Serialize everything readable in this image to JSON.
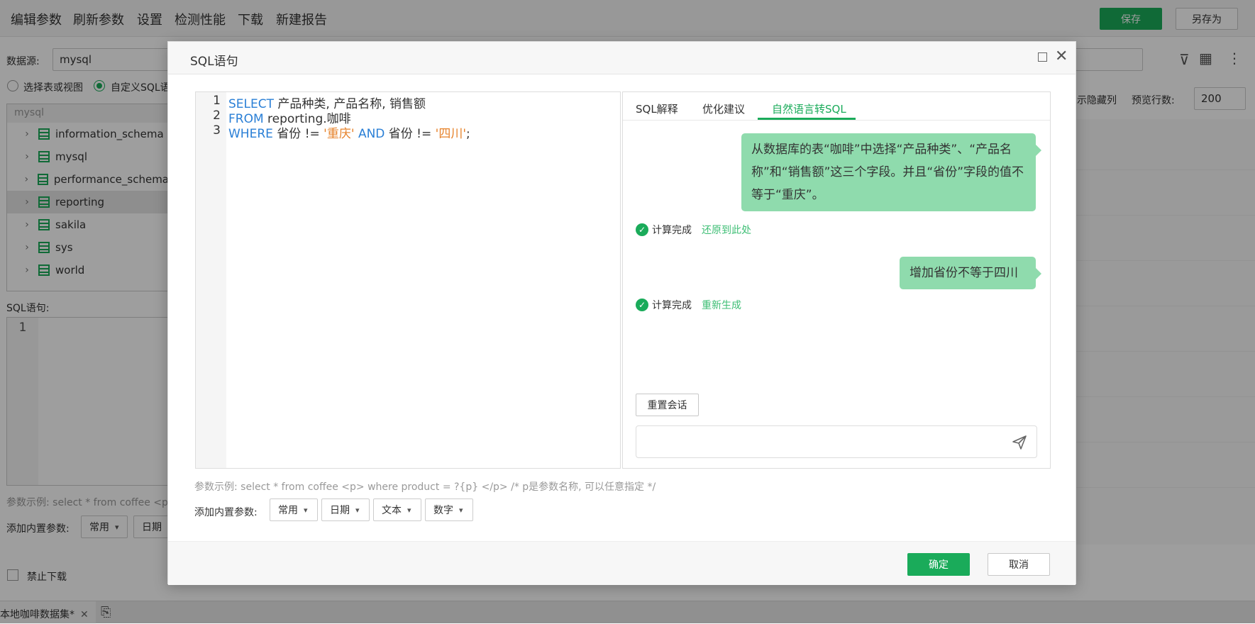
{
  "menubar": {
    "items": [
      "编辑参数",
      "刷新参数",
      "设置",
      "检测性能",
      "下载",
      "新建报告"
    ],
    "save_label": "保存",
    "save_as_label": "另存为"
  },
  "left": {
    "datasource_label": "数据源:",
    "datasource_value": "mysql",
    "radio_table_label": "选择表或视图",
    "radio_custom_label": "自定义SQL语",
    "tree_header": "mysql",
    "tree_items": [
      "information_schema",
      "mysql",
      "performance_schema",
      "reporting",
      "sakila",
      "sys",
      "world"
    ],
    "sql_label": "SQL语句:",
    "sql_line": "1",
    "param_example": "参数示例: select * from coffee <p",
    "add_param_label": "添加内置参数:",
    "common_label": "常用",
    "date_label": "日期",
    "disable_download": "禁止下载"
  },
  "right_bg": {
    "show_hidden": "示隐藏列",
    "preview_rows_label": "预览行数:",
    "preview_rows_value": "200"
  },
  "bottom": {
    "file_tab": "本地咖啡数据集*"
  },
  "dialog": {
    "title": "SQL语句",
    "code_lines": [
      {
        "num": "1",
        "parts": [
          [
            "kw",
            "SELECT"
          ],
          [
            "",
            " 产品种类, 产品名称, 销售额"
          ]
        ]
      },
      {
        "num": "2",
        "parts": [
          [
            "kw",
            "FROM"
          ],
          [
            "",
            " reporting.咖啡"
          ]
        ]
      },
      {
        "num": "3",
        "parts": [
          [
            "kw",
            "WHERE"
          ],
          [
            "",
            " 省份 != "
          ],
          [
            "str",
            "'重庆'"
          ],
          [
            "",
            " "
          ],
          [
            "kw",
            "AND"
          ],
          [
            "",
            " 省份 != "
          ],
          [
            "str",
            "'四川'"
          ],
          [
            "",
            ";"
          ]
        ]
      }
    ],
    "tabs": [
      "SQL解释",
      "优化建议",
      "自然语言转SQL"
    ],
    "messages": [
      {
        "text": "从数据库的表“咖啡”中选择“产品种类”、“产品名称”和“销售额”这三个字段。并且“省份”字段的值不等于“重庆”。"
      },
      {
        "text": "增加省份不等于四川"
      }
    ],
    "status1": "计算完成",
    "status1_link": "还原到此处",
    "status2": "计算完成",
    "status2_link": "重新生成",
    "reset_label": "重置会话",
    "chat_placeholder": "",
    "param_hint": "参数示例: select * from coffee <p> where product = ?{p} </p> /* p是参数名称, 可以任意指定 */",
    "add_param_label": "添加内置参数:",
    "dropdowns": [
      "常用",
      "日期",
      "文本",
      "数字"
    ],
    "ok_label": "确定",
    "cancel_label": "取消"
  },
  "colors": {
    "accent": "#1aab5a",
    "bubble": "#8fdbad",
    "keyword": "#2a7fd6",
    "string": "#e6822a"
  }
}
